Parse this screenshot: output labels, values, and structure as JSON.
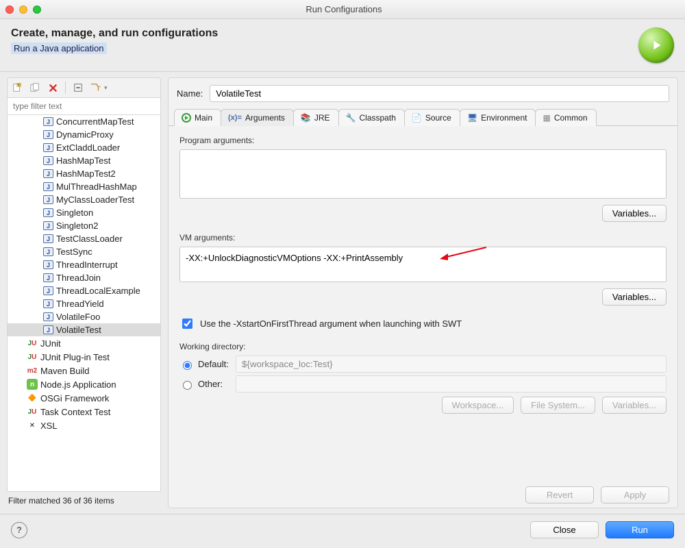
{
  "window": {
    "title": "Run Configurations"
  },
  "header": {
    "title": "Create, manage, and run configurations",
    "subtitle": "Run a Java application"
  },
  "toolbar": {
    "new_tip": "New",
    "duplicate_tip": "Duplicate",
    "delete_tip": "Delete",
    "collapse_tip": "Collapse All",
    "filter_tip": "Filter"
  },
  "filter": {
    "placeholder": "type filter text"
  },
  "tree": {
    "java_items": [
      "ConcurrentMapTest",
      "DynamicProxy",
      "ExtCladdLoader",
      "HashMapTest",
      "HashMapTest2",
      "MulThreadHashMap",
      "MyClassLoaderTest",
      "Singleton",
      "Singleton2",
      "TestClassLoader",
      "TestSync",
      "ThreadInterrupt",
      "ThreadJoin",
      "ThreadLocalExample",
      "ThreadYield",
      "VolatileFoo",
      "VolatileTest"
    ],
    "selected": "VolatileTest",
    "other_items": [
      {
        "icon": "ju",
        "label": "JUnit"
      },
      {
        "icon": "ju",
        "label": "JUnit Plug-in Test"
      },
      {
        "icon": "m2",
        "label": "Maven Build"
      },
      {
        "icon": "node",
        "label": "Node.js Application"
      },
      {
        "icon": "osgi",
        "label": "OSGi Framework"
      },
      {
        "icon": "ju",
        "label": "Task Context Test"
      },
      {
        "icon": "xsl",
        "label": "XSL"
      }
    ]
  },
  "filter_status": "Filter matched 36 of 36 items",
  "name": {
    "label": "Name:",
    "value": "VolatileTest"
  },
  "tabs": {
    "items": [
      "Main",
      "Arguments",
      "JRE",
      "Classpath",
      "Source",
      "Environment",
      "Common"
    ],
    "active": "Arguments"
  },
  "args": {
    "program_label": "Program arguments:",
    "program_value": "",
    "vm_label": "VM arguments:",
    "vm_value": "-XX:+UnlockDiagnosticVMOptions -XX:+PrintAssembly",
    "variables_btn": "Variables...",
    "swt_checkbox": "Use the -XstartOnFirstThread argument when launching with SWT",
    "swt_checked": true
  },
  "workdir": {
    "label": "Working directory:",
    "default_label": "Default:",
    "other_label": "Other:",
    "default_value": "${workspace_loc:Test}",
    "other_value": "",
    "selected": "default",
    "workspace_btn": "Workspace...",
    "filesystem_btn": "File System...",
    "variables_btn": "Variables..."
  },
  "footer": {
    "revert": "Revert",
    "apply": "Apply"
  },
  "bottom": {
    "close": "Close",
    "run": "Run"
  }
}
